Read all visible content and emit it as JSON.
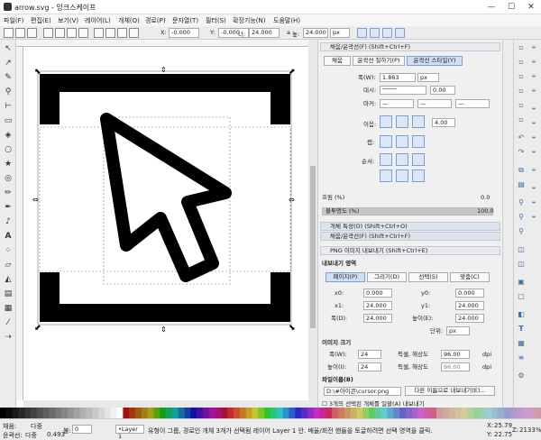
{
  "window": {
    "title": "arrow.svg - 잉크스케이프",
    "minimize": "—",
    "maximize": "☐",
    "close": "✕"
  },
  "menu": [
    "파일(F)",
    "편집(E)",
    "보기(V)",
    "레이어(L)",
    "개체(O)",
    "경로(P)",
    "문자열(T)",
    "필터(S)",
    "확장기능(N)",
    "도움말(H)"
  ],
  "controls": {
    "x_label": "X:",
    "x_value": "-0.000",
    "y_label": "Y:",
    "y_value": "-0.000",
    "w_label": "너:",
    "w_value": "24.000",
    "lock": "a",
    "h_label": "높:",
    "h_value": "24.000",
    "unit": "px"
  },
  "fill_stroke": {
    "header": "채움/윤곽선(F) (Shift+Ctrl+F)",
    "tabs": [
      "채움",
      "윤곽선 칠하기(P)",
      "윤곽선 스타일(Y)"
    ],
    "width_label": "폭(W):",
    "width_value": "1.863",
    "width_unit": "px",
    "dash_label": "대시:",
    "dash_offset": "0.00",
    "marker_label": "마커:",
    "marker_value": "—",
    "join_label": "이음:",
    "miter_value": "4.00",
    "cap_label": "캡:",
    "order_label": "순서:",
    "blur_label": "흐림 (%)",
    "blur_value": "0.0",
    "opacity_label": "불투명도 (%)",
    "opacity_value": "100.0"
  },
  "object_props": {
    "header": "개체 특성(O) (Shift+Ctrl+O)"
  },
  "fill_stroke2": {
    "header": "채움/윤곽선(F) (Shift+Ctrl+F)"
  },
  "export": {
    "header": "PNG 이미지 내보내기 (Shift+Ctrl+E)",
    "area_label": "내보내기 영역",
    "area_buttons": [
      "페이지(P)",
      "그리기(D)",
      "선택(S)",
      "맞춤(C)"
    ],
    "x0_label": "x0:",
    "x0": "0.000",
    "y0_label": "y0:",
    "y0": "0.000",
    "x1_label": "x1:",
    "x1": "24.000",
    "y1_label": "y1:",
    "y1": "24.000",
    "w_label": "폭(D):",
    "w": "24.000",
    "h_label": "높이(E):",
    "h": "24.000",
    "unit_label": "단위:",
    "unit": "px",
    "size_label": "이미지 크기",
    "iw_label": "폭(W):",
    "iw": "24",
    "dpi_label": "픽셀, 해상도",
    "dpi": "96.00",
    "dpi_unit": "dpi",
    "ih_label": "높이(I):",
    "ih": "24",
    "dpi2": "96.00",
    "file_label": "파일이름(B)",
    "filename": "D:\\#아이콘\\cursor.png",
    "saveas_button": "다른 이름으로 내보내기(E)...",
    "batch_label": "3개의 선택된 개체를 일괄(A) 내보내기"
  },
  "status": {
    "fill_label": "채움:",
    "fill_value": "다중",
    "stroke_label": "윤곽선:",
    "stroke_value": "다중",
    "stroke_width": "0.493",
    "opacity_label": "불:",
    "opacity_value": "0",
    "layer": "•Layer 1",
    "message": "유형이 그룹, 경로인 개체 3개가 선택됨 레이어 Layer 1 안. 배율/회전 핸들을 토글하려면 선택 영역을 클릭.",
    "x_label": "X:",
    "x": "25.79",
    "y_label": "Y:",
    "y": "22.75",
    "zoom_label": "Z:",
    "zoom": "2133%"
  },
  "colors": {
    "accent": "#3a6ea5",
    "selected_tab": "#cfe0f5"
  }
}
